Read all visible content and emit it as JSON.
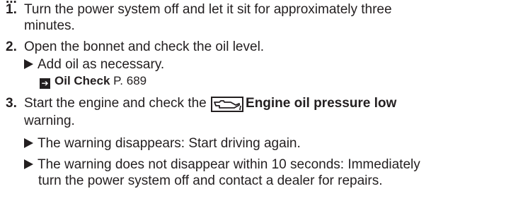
{
  "heading_fragment": "...",
  "steps": [
    {
      "num": "1.",
      "line1": "Turn the power system off and let it sit for approximately three",
      "line2": "minutes."
    },
    {
      "num": "2.",
      "line1": "Open the bonnet and check the oil level.",
      "bullet": "Add oil as necessary.",
      "ref_title": "Oil Check",
      "ref_page": "P. 689"
    },
    {
      "num": "3.",
      "line1_pre": "Start the engine and check the",
      "line1_bold": "Engine oil pressure low",
      "line2": "warning.",
      "bullet1": "The warning disappears: Start driving again.",
      "bullet2_line1": "The warning does not disappear within 10 seconds: Immediately",
      "bullet2_line2": "turn the power system off and contact a dealer for repairs."
    }
  ],
  "icons": {
    "oil_pressure": "oil-pressure-warning-icon"
  }
}
